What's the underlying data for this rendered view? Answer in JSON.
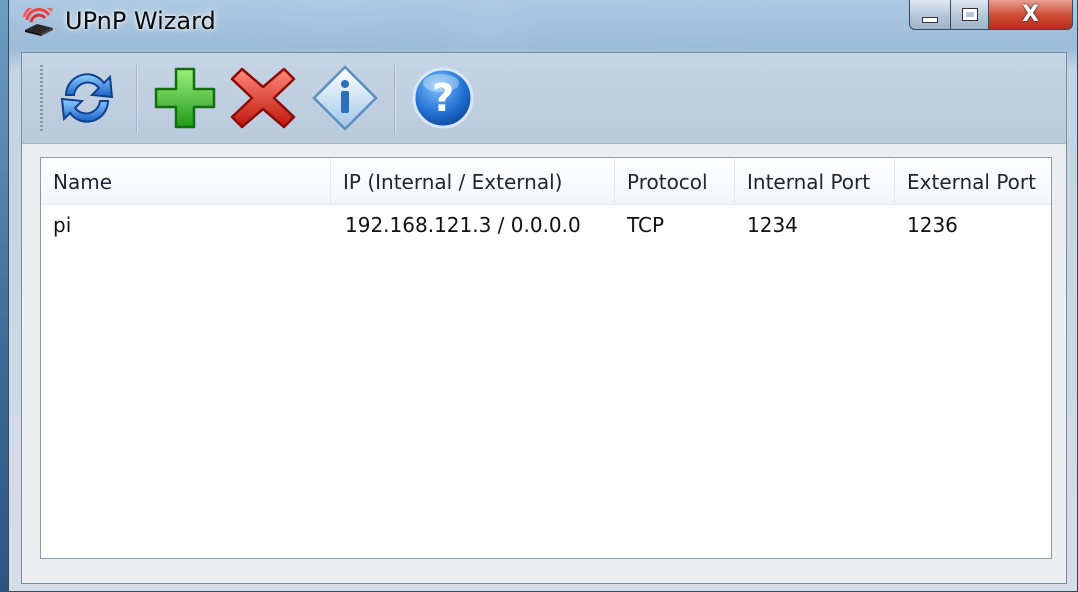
{
  "window": {
    "title": "UPnP Wizard",
    "controls": {
      "minimize": "minimize",
      "maximize": "maximize",
      "close": "X"
    }
  },
  "toolbar": {
    "buttons": [
      {
        "name": "refresh",
        "icon": "refresh-arrows-icon"
      },
      {
        "name": "add",
        "icon": "green-plus-icon"
      },
      {
        "name": "delete",
        "icon": "red-x-icon"
      },
      {
        "name": "info",
        "icon": "info-diamond-icon"
      },
      {
        "name": "help",
        "icon": "blue-question-icon"
      }
    ]
  },
  "table": {
    "columns": [
      "Name",
      "IP (Internal / External)",
      "Protocol",
      "Internal Port",
      "External Port"
    ],
    "rows": [
      {
        "name": "pi",
        "ip": "192.168.121.3 / 0.0.0.0",
        "protocol": "TCP",
        "internal_port": "1234",
        "external_port": "1236"
      }
    ]
  },
  "colors": {
    "toolbar_bg": "#c6d5e5",
    "close_button": "#d0503a",
    "add_green": "#3cbf2c",
    "delete_red": "#e0261b",
    "help_blue": "#1f6fd1"
  }
}
